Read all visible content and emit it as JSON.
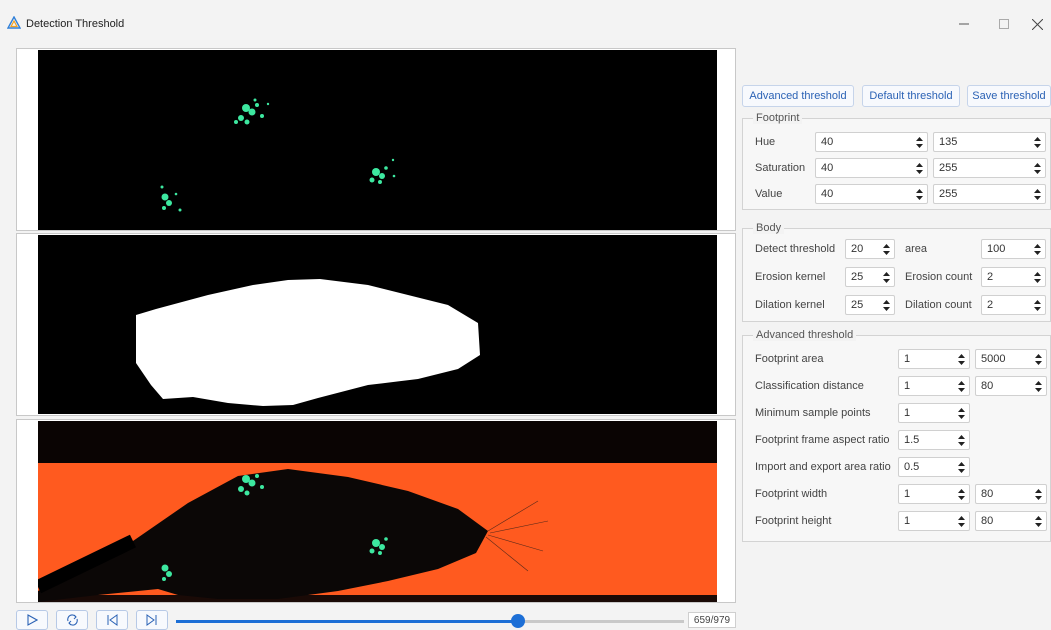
{
  "window": {
    "title": "Detection Threshold",
    "icon": "triangle-logo-icon",
    "controls": [
      "minimize-icon",
      "maximize-icon",
      "close-icon"
    ]
  },
  "colors": {
    "accent": "#1d6fd6",
    "overlay_background": "#ff5a1f",
    "footprint_green": "#3de8a0"
  },
  "toolbar": {
    "advanced_threshold": "Advanced threshold",
    "default_threshold": "Default threshold",
    "save_threshold": "Save threshold"
  },
  "footprint": {
    "title": "Footprint",
    "hue": {
      "label": "Hue",
      "min": "40",
      "max": "135"
    },
    "saturation": {
      "label": "Saturation",
      "min": "40",
      "max": "255"
    },
    "value": {
      "label": "Value",
      "min": "40",
      "max": "255"
    }
  },
  "body": {
    "title": "Body",
    "detect_threshold": {
      "label": "Detect threshold",
      "value": "20"
    },
    "area": {
      "label": "area",
      "value": "100"
    },
    "erosion_kernel": {
      "label": "Erosion kernel",
      "value": "25"
    },
    "erosion_count": {
      "label": "Erosion count",
      "value": "2"
    },
    "dilation_kernel": {
      "label": "Dilation kernel",
      "value": "25"
    },
    "dilation_count": {
      "label": "Dilation count",
      "value": "2"
    }
  },
  "advanced": {
    "title": "Advanced threshold",
    "footprint_area": {
      "label": "Footprint area",
      "min": "1",
      "max": "5000"
    },
    "classification_distance": {
      "label": "Classification distance",
      "min": "1",
      "max": "80"
    },
    "minimum_sample_points": {
      "label": "Minimum sample points",
      "value": "1"
    },
    "frame_aspect_ratio": {
      "label": "Footprint frame aspect ratio",
      "value": "1.5"
    },
    "import_export_area_ratio": {
      "label": "Import and export area ratio",
      "value": "0.5"
    },
    "footprint_width": {
      "label": "Footprint width",
      "min": "1",
      "max": "80"
    },
    "footprint_height": {
      "label": "Footprint height",
      "min": "1",
      "max": "80"
    }
  },
  "playback": {
    "buttons": [
      "play-icon",
      "loop-icon",
      "previous-frame-icon",
      "next-frame-icon"
    ],
    "current_frame": 659,
    "total_frames": 979,
    "frame_label": "659/979",
    "progress_fraction": 0.673
  }
}
